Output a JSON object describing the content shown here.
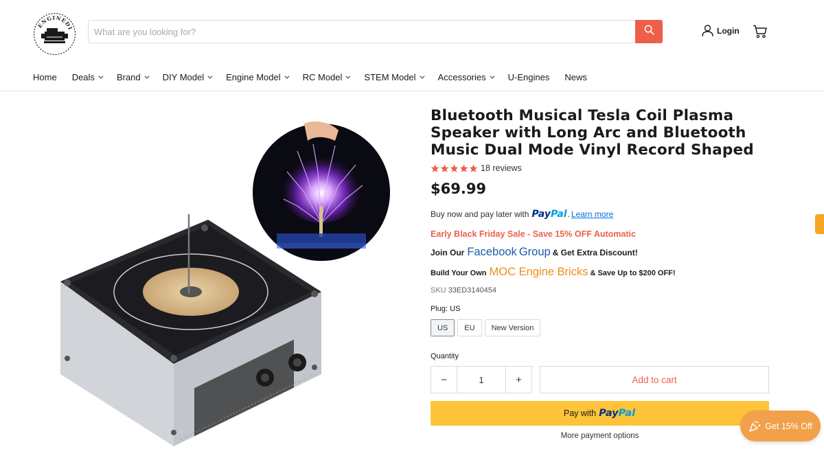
{
  "header": {
    "logo_text": "ENGINEDIY",
    "search_placeholder": "What are you looking for?",
    "login_label": "Login"
  },
  "nav": [
    {
      "label": "Home",
      "dropdown": false
    },
    {
      "label": "Deals",
      "dropdown": true
    },
    {
      "label": "Brand",
      "dropdown": true
    },
    {
      "label": "DIY Model",
      "dropdown": true
    },
    {
      "label": "Engine Model",
      "dropdown": true
    },
    {
      "label": "RC Model",
      "dropdown": true
    },
    {
      "label": "STEM Model",
      "dropdown": true
    },
    {
      "label": "Accessories",
      "dropdown": true
    },
    {
      "label": "U-Engines",
      "dropdown": false
    },
    {
      "label": "News",
      "dropdown": false
    }
  ],
  "product": {
    "title": "Bluetooth Musical Tesla Coil Plasma Speaker with Long Arc and Bluetooth Music Dual Mode Vinyl Record Shaped",
    "rating": 5,
    "reviews": "18 reviews",
    "price": "$69.99",
    "paypal_later": {
      "prefix": "Buy now and pay later with",
      "pay": "Pay",
      "pal": "Pal",
      "suffix": ".",
      "link": "Learn more"
    },
    "promo": "Early Black Friday Sale - Save 15% OFF Automatic",
    "facebook_line": {
      "prefix": "Join Our",
      "brand": "Facebook",
      "group": "Group",
      "suffix": "& Get Extra Discount!"
    },
    "moc_line": {
      "prefix": "Build Your Own",
      "brand": "MOC Engine Bricks",
      "suffix": "& Save Up to $200 OFF!"
    },
    "sku_label": "SKU",
    "sku_value": "33ED3140454",
    "plug_label": "Plug: US",
    "variants": [
      "US",
      "EU",
      "New Version"
    ],
    "selected_variant": "US",
    "quantity_label": "Quantity",
    "quantity": "1",
    "minus": "−",
    "plus": "+",
    "add_to_cart": "Add to cart",
    "paypal_button": {
      "prefix": "Pay with",
      "pay": "Pay",
      "pal": "Pal"
    },
    "more_options": "More payment options"
  },
  "floating": {
    "discount_label": "Get 15% Off"
  },
  "colors": {
    "accent": "#ee5f4a",
    "star": "#ee5f4a",
    "paypal_yellow": "#ffc439",
    "facebook_blue": "#1a5dab",
    "moc_orange": "#f08a1a",
    "discount_orange": "#f2a14a"
  }
}
